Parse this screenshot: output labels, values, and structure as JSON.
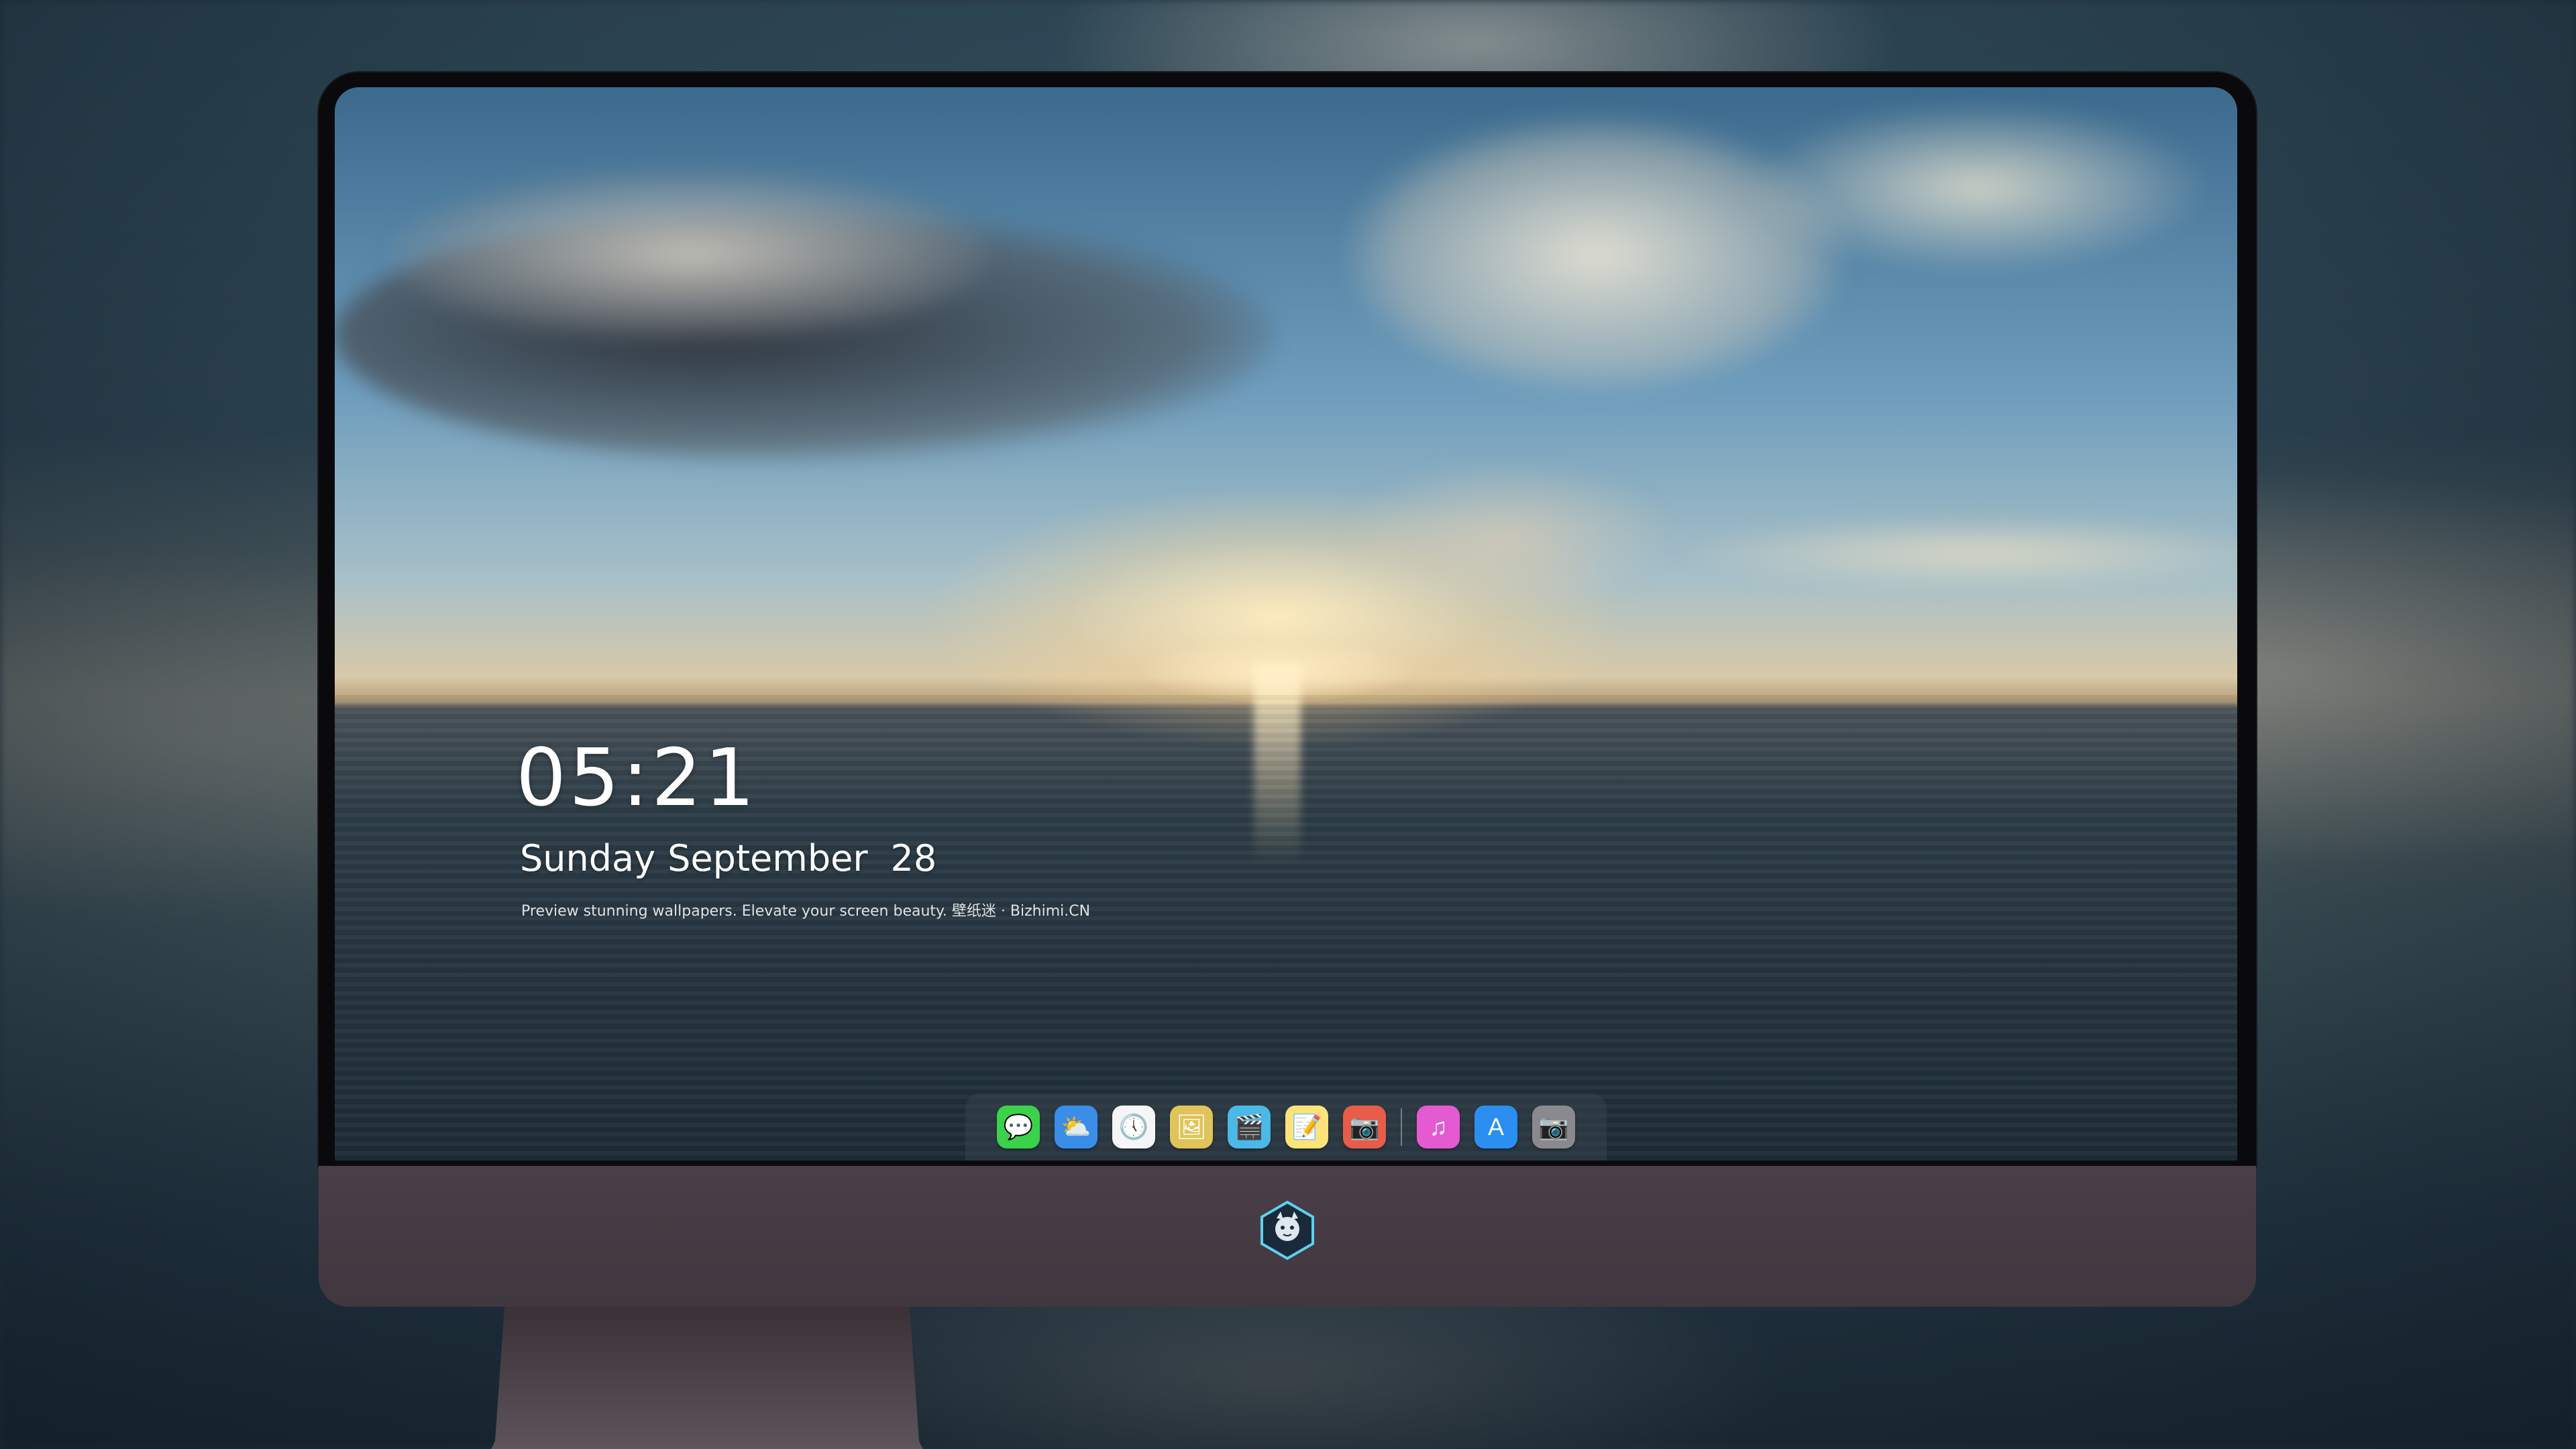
{
  "lock_screen": {
    "time": "05:21",
    "weekday": "Sunday",
    "month": "September",
    "day": "28",
    "tagline": "Preview stunning wallpapers. Elevate your screen beauty. 壁纸迷 · Bizhimi.CN"
  },
  "dock": {
    "apps": [
      {
        "name": "Messages",
        "icon": "messages-icon",
        "color": "#3bd14b",
        "glyph": "💬"
      },
      {
        "name": "Weather",
        "icon": "weather-icon",
        "color": "#3a8ee8",
        "glyph": "⛅"
      },
      {
        "name": "Clock",
        "icon": "clock-icon",
        "color": "#f5f5f5",
        "glyph": "🕔"
      },
      {
        "name": "Preview",
        "icon": "preview-icon",
        "color": "#e0c45a",
        "glyph": "🖼"
      },
      {
        "name": "Clips",
        "icon": "clips-icon",
        "color": "#4bb8e8",
        "glyph": "🎬"
      },
      {
        "name": "Notes",
        "icon": "notes-icon",
        "color": "#fde37a",
        "glyph": "📝"
      },
      {
        "name": "Photo Booth",
        "icon": "photo-booth-icon",
        "color": "#e85c4a",
        "glyph": "📷"
      },
      {
        "name": "Music",
        "icon": "music-icon",
        "color": "#e45ad0",
        "glyph": "♫"
      },
      {
        "name": "App Store",
        "icon": "app-store-icon",
        "color": "#2b8ef0",
        "glyph": "A"
      },
      {
        "name": "Camera",
        "icon": "camera-icon",
        "color": "#8a8a8e",
        "glyph": "📷"
      }
    ]
  },
  "colors": {
    "bezel": "#0a0a0c",
    "chin": "#4a3f48",
    "stand": "#2f2a30"
  }
}
